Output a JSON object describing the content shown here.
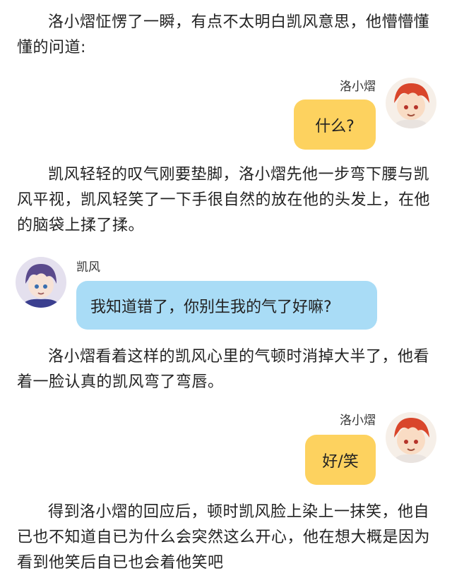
{
  "paragraphs": [
    "洛小熠怔愣了一瞬，有点不太明白凯风意思，他懵懵懂懂的问道:",
    "凯风轻轻的叹气刚要垫脚，洛小熠先他一步弯下腰与凯风平视，凯风轻笑了一下手很自然的放在他的头发上，在他的脑袋上揉了揉。",
    "洛小熠看着这样的凯风心里的气顿时消掉大半了，他看着一脸认真的凯风弯了弯唇。",
    "得到洛小熠的回应后，顿时凯风脸上染上一抹笑，他自已也不知道自已为什么会突然这么开心，他在想大概是因为看到他笑后自已也会着他笑吧"
  ],
  "messages": [
    {
      "sender": "洛小熠",
      "text": "什么?",
      "avatar": "red-hair-boy-avatar",
      "bubble_color": "#fdd25f"
    },
    {
      "sender": "凯风",
      "text": "我知道错了，你别生我的气了好嘛?",
      "avatar": "purple-hair-boy-avatar",
      "bubble_color": "#a9dcf6"
    },
    {
      "sender": "洛小熠",
      "text": "好/笑",
      "avatar": "red-hair-boy-avatar",
      "bubble_color": "#fdd25f"
    }
  ]
}
